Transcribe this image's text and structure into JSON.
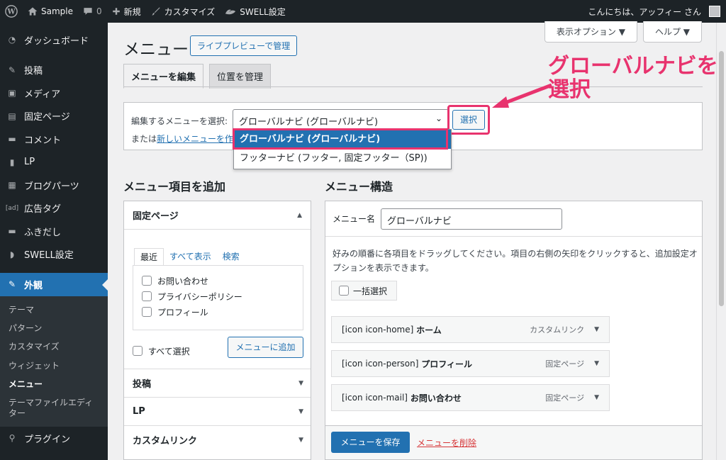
{
  "adminbar": {
    "site_name": "Sample",
    "comments_count": "0",
    "new_label": "新規",
    "customize_label": "カスタマイズ",
    "swell_label": "SWELL設定",
    "greeting": "こんにちは、アッフィー さん"
  },
  "sidebar": {
    "items": [
      {
        "label": "ダッシュボード",
        "icon": "dashboard-icon"
      },
      {
        "label": "投稿",
        "icon": "pin-icon"
      },
      {
        "label": "メディア",
        "icon": "media-icon"
      },
      {
        "label": "固定ページ",
        "icon": "page-icon"
      },
      {
        "label": "コメント",
        "icon": "comment-icon"
      },
      {
        "label": "LP",
        "icon": "file-icon"
      },
      {
        "label": "ブログパーツ",
        "icon": "blocks-icon"
      },
      {
        "label": "広告タグ",
        "icon": "ad-icon"
      },
      {
        "label": "ふきだし",
        "icon": "balloon-icon"
      },
      {
        "label": "SWELL設定",
        "icon": "swell-icon"
      }
    ],
    "current": {
      "label": "外観",
      "icon": "appearance-icon"
    },
    "submenu": [
      "テーマ",
      "パターン",
      "カスタマイズ",
      "ウィジェット",
      "メニュー",
      "テーマファイルエディター"
    ],
    "submenu_current": "メニュー",
    "plugins": {
      "label": "プラグイン",
      "icon": "plugin-icon"
    }
  },
  "screen_meta": {
    "options": "表示オプション ▼",
    "help": "ヘルプ ▼"
  },
  "page": {
    "title": "メニュー",
    "live_preview": "ライブプレビューで管理",
    "tabs": [
      "メニューを編集",
      "位置を管理"
    ]
  },
  "manage": {
    "label": "編集するメニューを選択:",
    "selected": "グローバルナビ (グローバルナビ)",
    "select_button": "選択",
    "or_text": "または",
    "new_link": "新しいメニューを作",
    "options": [
      "グローバルナビ (グローバルナビ)",
      "フッターナビ (フッター, 固定フッター（SP))"
    ]
  },
  "annotation": {
    "line1": "グローバルナビを",
    "line2": "選択",
    "color": "#e8336e"
  },
  "add_items": {
    "heading": "メニュー項目を追加",
    "section_title": "固定ページ",
    "inner_tabs": [
      "最近",
      "すべて表示",
      "検索"
    ],
    "pages": [
      "お問い合わせ",
      "プライバシーポリシー",
      "プロフィール"
    ],
    "select_all": "すべて選択",
    "add_button": "メニューに追加",
    "other_sections": [
      "投稿",
      "LP",
      "カスタムリンク"
    ]
  },
  "structure": {
    "heading": "メニュー構造",
    "name_label": "メニュー名",
    "name_value": "グローバルナビ",
    "instructions": "好みの順番に各項目をドラッグしてください。項目の右側の矢印をクリックすると、追加設定オプションを表示できます。",
    "bulk_select": "一括選択",
    "items": [
      {
        "prefix": "[icon icon-home]",
        "title": "ホーム",
        "type": "カスタムリンク"
      },
      {
        "prefix": "[icon icon-person]",
        "title": "プロフィール",
        "type": "固定ページ"
      },
      {
        "prefix": "[icon icon-mail]",
        "title": "お問い合わせ",
        "type": "固定ページ"
      }
    ],
    "save_button": "メニューを保存",
    "delete_link": "メニューを削除"
  },
  "colors": {
    "accent": "#2271b1",
    "sidebar_bg": "#1d2327",
    "highlight": "#e8336e"
  }
}
